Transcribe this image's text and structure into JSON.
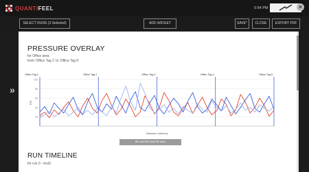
{
  "app": {
    "brand_prefix": "QUANTI",
    "brand_suffix": "FEEL",
    "clock": "5:54 PM",
    "colors": {
      "brand_red": "#d33a3a",
      "series_red": "#e4452e",
      "series_blue": "#3b5fd9",
      "series_light": "#9db3ee"
    }
  },
  "toolbar": {
    "select_runs": "SELECT RUNS (3 Selected)",
    "add_widget": "ADD WIDGET",
    "save": "SAVE*",
    "close": "CLOSE",
    "export_pdf": "EXPORT PDF"
  },
  "report": {
    "title": "PRESSURE OVERLAY",
    "subtitle1": "for Office area",
    "subtitle2": "from 'Office Tag 1' to 'Office Tag 5'",
    "legend_text": "Rft. test3   Rft. test2   Rft. test1",
    "section2_title": "RUN TIMELINE",
    "section2_sub": "for run 0 - test3"
  },
  "chart_data": {
    "type": "line",
    "xlabel": "Distance (meters)",
    "ylabel": "PSI",
    "tag_labels": [
      "Office Tag 1",
      "Office Tag 2",
      "Office Tag 3",
      "Office Tag 4",
      "Office Tag 5"
    ],
    "y_ticks": [
      "100",
      "80",
      "60",
      "40",
      "20"
    ],
    "grid": true,
    "legend_placement": "bottom",
    "series": [
      {
        "name": "test3",
        "color": "#e4452e",
        "values": [
          22,
          30,
          18,
          35,
          25,
          40,
          52,
          33,
          20,
          44,
          60,
          38,
          28,
          55,
          70,
          45,
          24,
          36,
          58,
          42,
          20,
          30,
          65,
          48,
          26,
          40,
          72,
          55,
          30,
          22,
          38,
          50,
          27,
          45,
          62,
          40,
          24,
          33,
          58,
          47,
          22,
          35,
          68,
          52,
          28,
          40,
          60,
          44,
          21,
          34
        ]
      },
      {
        "name": "test2",
        "color": "#3b5fd9",
        "values": [
          30,
          42,
          26,
          50,
          38,
          28,
          46,
          62,
          35,
          24,
          52,
          70,
          41,
          30,
          48,
          36,
          64,
          45,
          28,
          56,
          74,
          40,
          32,
          50,
          66,
          38,
          26,
          44,
          60,
          48,
          30,
          54,
          72,
          42,
          28,
          36,
          58,
          46,
          32,
          62,
          44,
          26,
          40,
          56,
          70,
          38,
          30,
          48,
          64,
          36
        ]
      },
      {
        "name": "test1",
        "color": "#9db3ee",
        "values": [
          18,
          24,
          32,
          20,
          28,
          36,
          22,
          30,
          40,
          26,
          34,
          24,
          38,
          30,
          22,
          44,
          28,
          60,
          86,
          52,
          34,
          92,
          70,
          40,
          28,
          36,
          46,
          30,
          38,
          26,
          42,
          34,
          28,
          48,
          36,
          30,
          54,
          40,
          32,
          44,
          28,
          36,
          50,
          34,
          40,
          30,
          46,
          38,
          32,
          42
        ]
      }
    ]
  }
}
